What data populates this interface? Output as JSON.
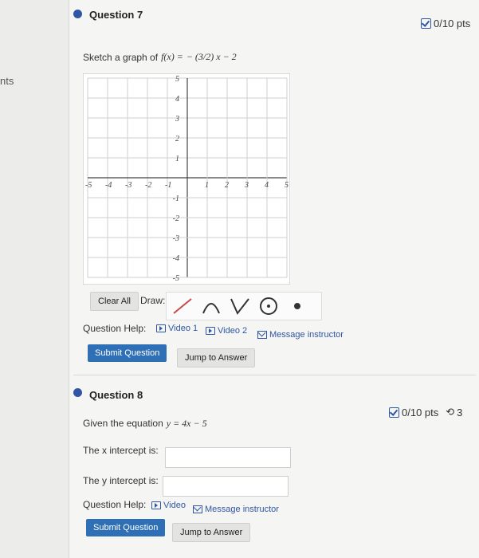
{
  "page": {
    "left_cut_text": "nts"
  },
  "q7": {
    "title": "Question 7",
    "points": "0/10 pts",
    "prompt_prefix": "Sketch a graph of ",
    "function_lhs": "f(x) =",
    "function_rhs": "− (3/2) x − 2",
    "graph": {
      "x_ticks": [
        "-5",
        "-4",
        "-3",
        "-2",
        "-1",
        "1",
        "2",
        "3",
        "4",
        "5"
      ],
      "y_ticks": [
        "5",
        "4",
        "3",
        "2",
        "1",
        "-1",
        "-2",
        "-3",
        "-4",
        "-5"
      ]
    },
    "clear_all_label": "Clear All",
    "draw_label": "Draw:",
    "tools": [
      "line-tool",
      "parabola-tool",
      "absolute-value-tool",
      "circle-tool",
      "point-tool"
    ],
    "help_label": "Question Help:",
    "help_links": [
      "Video 1",
      "Video 2",
      "Message instructor"
    ],
    "submit_label": "Submit Question",
    "jump_label": "Jump to Answer"
  },
  "q8": {
    "title": "Question 8",
    "points": "0/10 pts",
    "tries_count": "3",
    "prompt_prefix": "Given the equation ",
    "equation": "y = 4x − 5",
    "x_intercept_label": "The x intercept is:",
    "y_intercept_label": "The y intercept is:",
    "help_label": "Question Help:",
    "help_links": [
      "Video",
      "Message instructor"
    ],
    "submit_label": "Submit Question",
    "jump_label": "Jump to Answer"
  }
}
